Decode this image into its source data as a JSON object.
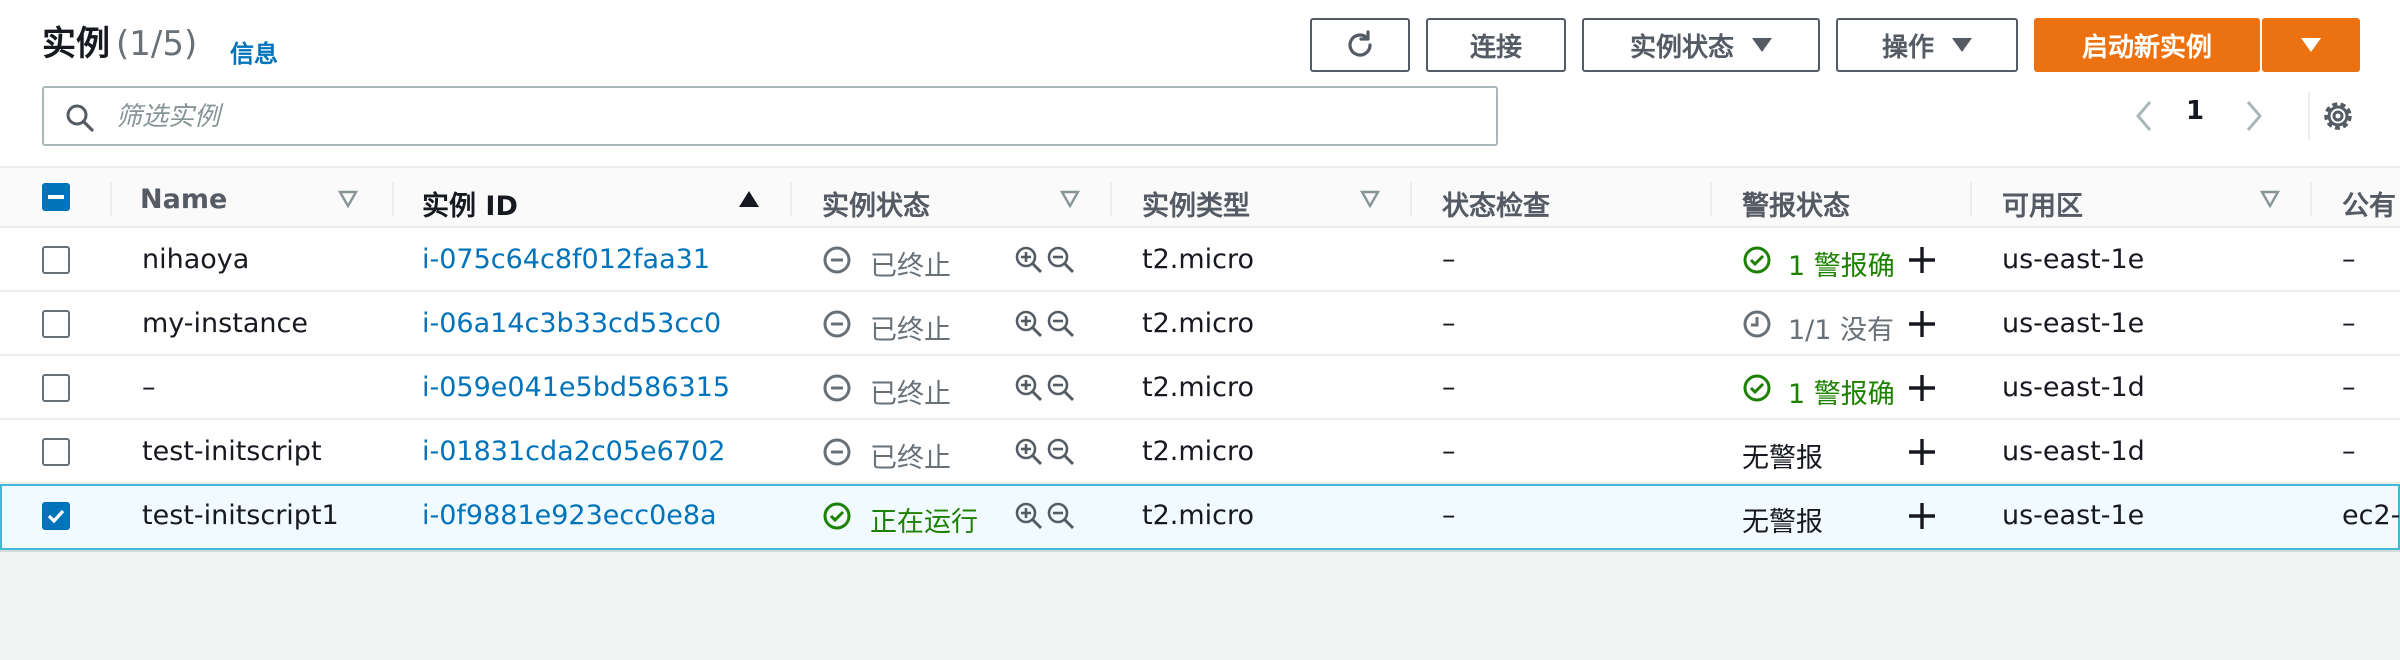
{
  "header": {
    "title": "实例",
    "count": "(1/5)",
    "info_link": "信息"
  },
  "toolbar": {
    "refresh_icon": "refresh-icon",
    "connect_label": "连接",
    "instance_state_label": "实例状态",
    "actions_label": "操作",
    "launch_label": "启动新实例"
  },
  "search": {
    "placeholder": "筛选实例",
    "value": ""
  },
  "pagination": {
    "current_page": "1"
  },
  "columns": [
    "Name",
    "实例 ID",
    "实例状态",
    "实例类型",
    "状态检查",
    "警报状态",
    "可用区",
    "公有"
  ],
  "rows": [
    {
      "name": "nihaoya",
      "id": "i-075c64c8f012faa31",
      "state": "已终止",
      "state_kind": "terminated",
      "type": "t2.micro",
      "check": "–",
      "alarm": "1 警报确",
      "alarm_kind": "ok",
      "az": "us-east-1e",
      "public": "–",
      "selected": false
    },
    {
      "name": "my-instance",
      "id": "i-06a14c3b33cd53cc0",
      "state": "已终止",
      "state_kind": "terminated",
      "type": "t2.micro",
      "check": "–",
      "alarm": "1/1 没有",
      "alarm_kind": "pending",
      "az": "us-east-1e",
      "public": "–",
      "selected": false
    },
    {
      "name": "–",
      "id": "i-059e041e5bd586315",
      "state": "已终止",
      "state_kind": "terminated",
      "type": "t2.micro",
      "check": "–",
      "alarm": "1 警报确",
      "alarm_kind": "ok",
      "az": "us-east-1d",
      "public": "–",
      "selected": false
    },
    {
      "name": "test-initscript",
      "id": "i-01831cda2c05e6702",
      "state": "已终止",
      "state_kind": "terminated",
      "type": "t2.micro",
      "check": "–",
      "alarm": "无警报",
      "alarm_kind": "none",
      "az": "us-east-1d",
      "public": "–",
      "selected": false
    },
    {
      "name": "test-initscript1",
      "id": "i-0f9881e923ecc0e8a",
      "state": "正在运行",
      "state_kind": "running",
      "type": "t2.micro",
      "check": "–",
      "alarm": "无警报",
      "alarm_kind": "none",
      "az": "us-east-1e",
      "public": "ec2-",
      "selected": true
    }
  ],
  "colors": {
    "accent": "#ec7211",
    "link": "#0073bb",
    "success": "#1d8102",
    "muted": "#687078"
  }
}
